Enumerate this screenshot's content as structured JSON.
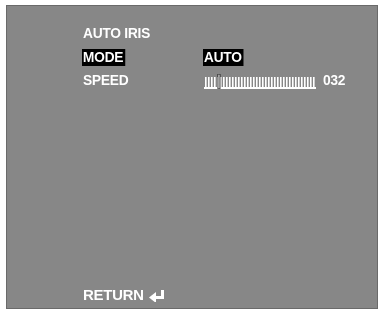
{
  "menu": {
    "title": "AUTO IRIS",
    "items": [
      {
        "label": "MODE",
        "value": "AUTO",
        "selected": true
      },
      {
        "label": "SPEED",
        "value_text": "032",
        "level": 0.12
      }
    ],
    "return_label": "RETURN",
    "return_icon": "enter-return-icon"
  },
  "colors": {
    "screen_bg": "#878787",
    "text": "#ffffff",
    "highlight_bg": "#000000"
  }
}
